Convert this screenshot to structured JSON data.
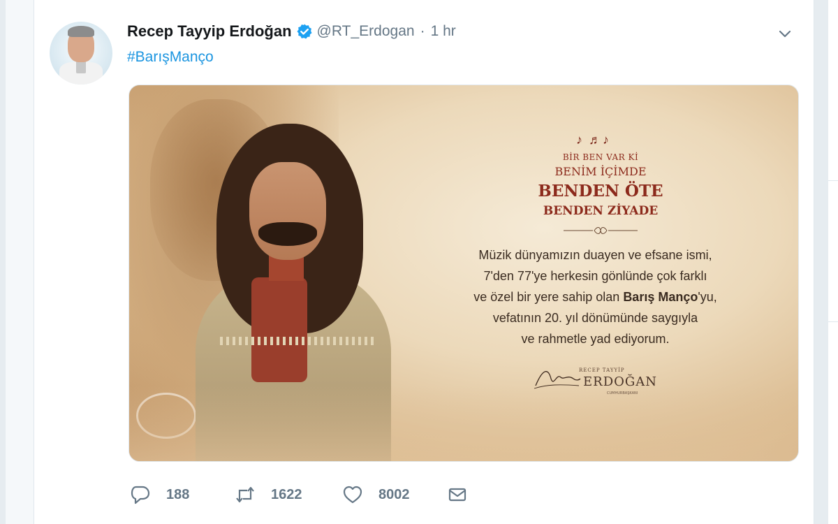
{
  "tweet": {
    "author_name": "Recep Tayyip Erdoğan",
    "handle": "@RT_Erdogan",
    "separator": "·",
    "time": "1 hr",
    "hashtag": "#BarışManço"
  },
  "media": {
    "notes": "♪ ♬♪",
    "quote_line1": "BİR BEN VAR Kİ",
    "quote_line2": "BENİM İÇİMDE",
    "quote_line3": "BENDEN ÖTE",
    "quote_line4": "BENDEN ZİYADE",
    "message_line1": "Müzik dünyamızın duayen ve efsane ismi,",
    "message_line2": "7'den 77'ye herkesin gönlünde çok farklı",
    "message_line3_pre": "ve özel bir yere sahip olan ",
    "message_line3_bold": "Barış Manço",
    "message_line3_post": "'yu,",
    "message_line4": "vefatının 20. yıl dönümünde saygıyla",
    "message_line5": "ve rahmetle yad ediyorum.",
    "signature_small": "RECEP TAYYİP",
    "signature_name": "ERDOĞAN",
    "signature_title": "CUMHURBAŞKANI"
  },
  "actions": {
    "replies": "188",
    "retweets": "1622",
    "likes": "8002"
  },
  "colors": {
    "link": "#1b95e0",
    "verified": "#1da1f2",
    "muted": "#657786",
    "quote_red": "#8c2a1c"
  },
  "icons": [
    "verified-badge-icon",
    "caret-down-icon",
    "reply-icon",
    "retweet-icon",
    "like-icon",
    "direct-message-icon"
  ]
}
